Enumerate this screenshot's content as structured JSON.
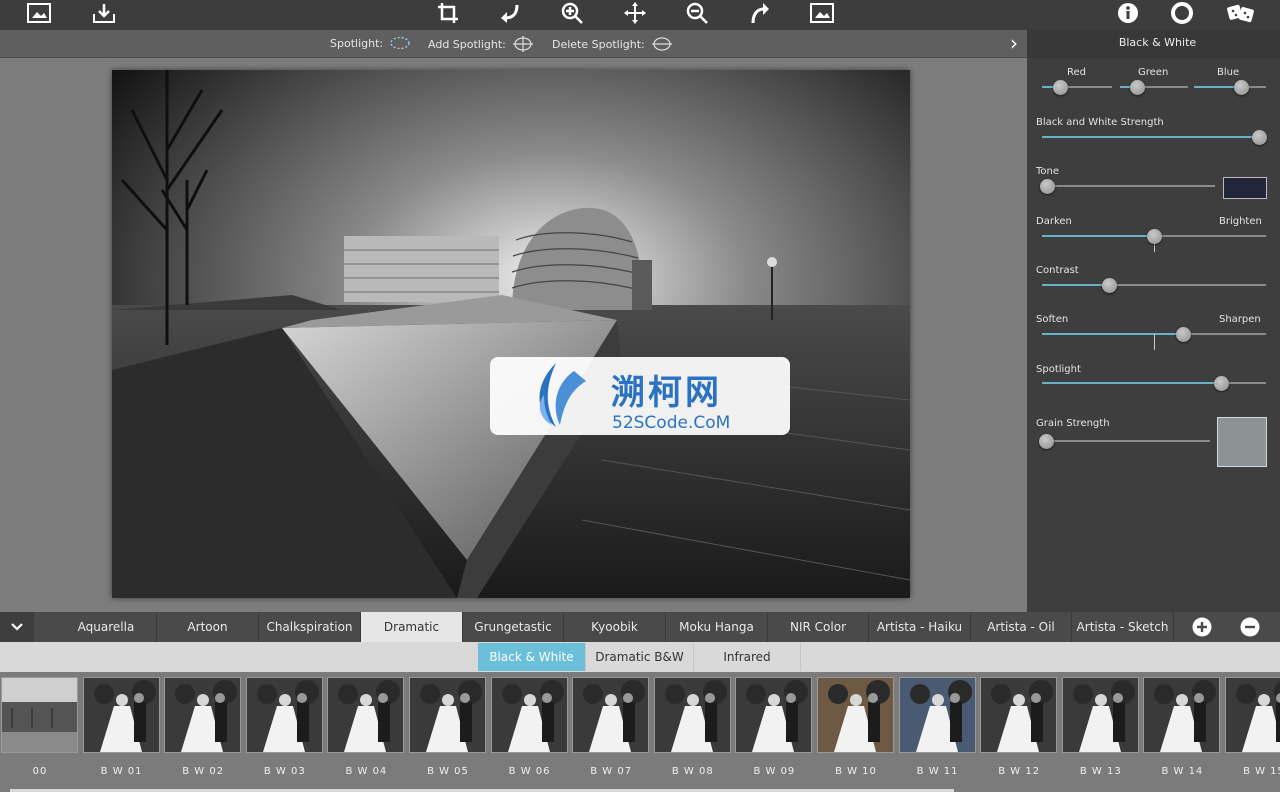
{
  "spotlight_bar": {
    "spotlight": "Spotlight:",
    "add_spotlight": "Add Spotlight:",
    "delete_spotlight": "Delete Spotlight:"
  },
  "panel": {
    "title": "Black & White",
    "collapse_glyph": "›",
    "rgb": [
      {
        "label": "Red",
        "value": 0.25
      },
      {
        "label": "Green",
        "value": 0.25
      },
      {
        "label": "Blue",
        "value": 0.65
      }
    ],
    "bw_strength": {
      "label": "Black and White Strength",
      "value": 1.0
    },
    "tone": {
      "label": "Tone",
      "value": 0.03,
      "color": "#23253a"
    },
    "darken_brighten": {
      "left": "Darken",
      "right": "Brighten",
      "value": 0.5
    },
    "contrast": {
      "label": "Contrast",
      "value": 0.3
    },
    "soften_sharpen": {
      "left": "Soften",
      "right": "Sharpen",
      "value": 0.63
    },
    "spotlight": {
      "label": "Spotlight",
      "value": 0.8
    },
    "grain": {
      "label": "Grain Strength",
      "value": 0.0
    }
  },
  "tabs": [
    "Aquarella",
    "Artoon",
    "Chalkspiration",
    "Dramatic",
    "Grungetastic",
    "Kyoobik",
    "Moku Hanga",
    "NIR Color",
    "Artista - Haiku",
    "Artista - Oil",
    "Artista - Sketch"
  ],
  "active_tab": "Dramatic",
  "subtabs": [
    "Black & White",
    "Dramatic B&W",
    "Infrared"
  ],
  "active_subtab": "Black & White",
  "thumbnails": [
    "00",
    "B W 01",
    "B W 02",
    "B W 03",
    "B W 04",
    "B W 05",
    "B W 06",
    "B W 07",
    "B W 08",
    "B W 09",
    "B W 10",
    "B W 11",
    "B W 12",
    "B W 13",
    "B W 14",
    "B W 15"
  ],
  "watermark": {
    "cn": "溯柯网",
    "en": "52SCode.CoM"
  },
  "colors": {
    "accent": "#6cbfd8",
    "slider_fill": "#6ab0c8"
  }
}
